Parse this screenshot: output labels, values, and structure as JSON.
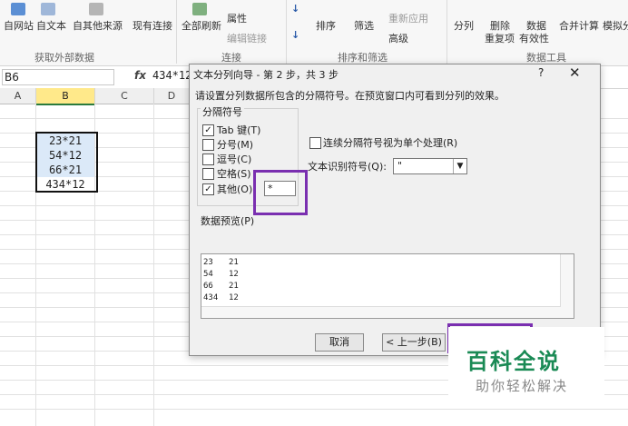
{
  "ribbon": {
    "items": [
      "自网站",
      "自文本",
      "自其他来源",
      "现有连接",
      "全部刷新",
      "属性",
      "编辑链接",
      "排序",
      "筛选",
      "重新应用",
      "高级",
      "分列",
      "删除",
      "重复项",
      "数据",
      "有效性",
      "合并计算",
      "模拟分"
    ],
    "groups": [
      "获取外部数据",
      "连接",
      "排序和筛选",
      "数据工具"
    ]
  },
  "formula_bar": {
    "name_box": "B6",
    "fx": "fx",
    "value": "434*12"
  },
  "columns": [
    "A",
    "B",
    "C",
    "D"
  ],
  "cells": [
    "23*21",
    "54*12",
    "66*21",
    "434*12"
  ],
  "dialog": {
    "title": "文本分列向导 - 第 2 步，共 3 步",
    "help": "?",
    "close": "✕",
    "description": "请设置分列数据所包含的分隔符号。在预览窗口内可看到分列的效果。",
    "delimiter_group": "分隔符号",
    "options": [
      {
        "label": "Tab 键(T)",
        "checked": true
      },
      {
        "label": "分号(M)",
        "checked": false
      },
      {
        "label": "逗号(C)",
        "checked": false
      },
      {
        "label": "空格(S)",
        "checked": false
      },
      {
        "label": "其他(O):",
        "checked": true
      }
    ],
    "other_value": "*",
    "treat_consecutive": "连续分隔符号视为单个处理(R)",
    "text_qualifier_label": "文本识别符号(Q):",
    "text_qualifier_value": "\"",
    "preview_label": "数据预览(P)",
    "preview_rows": [
      [
        "23",
        "21"
      ],
      [
        "54",
        "12"
      ],
      [
        "66",
        "21"
      ],
      [
        "434",
        "12"
      ]
    ],
    "btn_cancel": "取消",
    "btn_back": "< 上一步(B)"
  },
  "watermark": {
    "main": "百科全说",
    "sub": "助你轻松解决"
  }
}
